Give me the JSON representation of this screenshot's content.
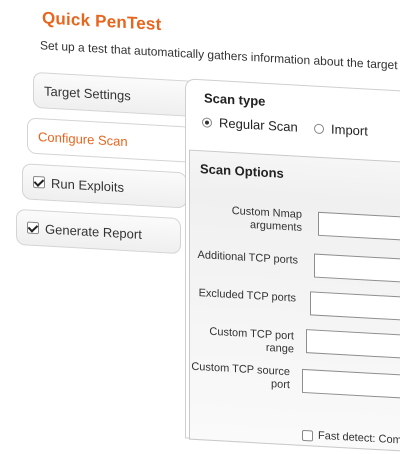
{
  "header": {
    "title": "Quick PenTest",
    "subtitle": "Set up a test that automatically gathers information about the target n"
  },
  "steps": [
    {
      "label": "Target Settings",
      "checked": false,
      "active": false
    },
    {
      "label": "Configure Scan",
      "checked": false,
      "active": true
    },
    {
      "label": "Run Exploits",
      "checked": true,
      "active": false
    },
    {
      "label": "Generate Report",
      "checked": true,
      "active": false
    }
  ],
  "scan_type": {
    "heading": "Scan type",
    "options": [
      {
        "label": "Regular Scan",
        "selected": true
      },
      {
        "label": "Import",
        "selected": false
      }
    ]
  },
  "scan_options": {
    "heading": "Scan Options",
    "fields": [
      {
        "label": "Custom Nmap arguments",
        "value": ""
      },
      {
        "label": "Additional TCP ports",
        "value": ""
      },
      {
        "label": "Excluded TCP ports",
        "value": ""
      },
      {
        "label": "Custom TCP port range",
        "value": ""
      },
      {
        "label": "Custom TCP source port",
        "value": ""
      }
    ],
    "fast_detect_label": "Fast detect: Comm",
    "fast_detect_checked": false
  },
  "colors": {
    "accent": "#e8651e"
  }
}
